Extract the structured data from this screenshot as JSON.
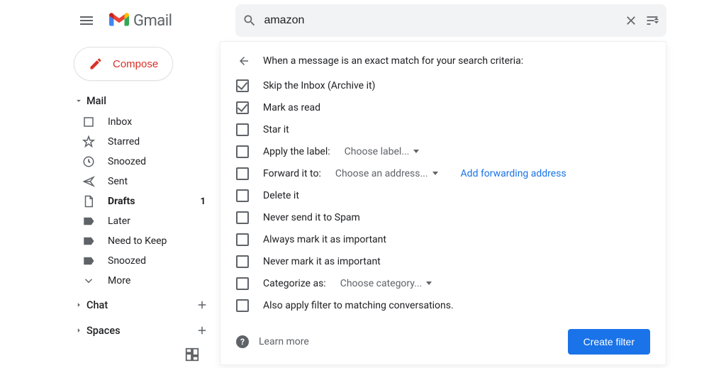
{
  "app": {
    "name": "Gmail"
  },
  "search": {
    "query": "amazon"
  },
  "compose": {
    "label": "Compose"
  },
  "sidebar": {
    "sections": {
      "mail": "Mail",
      "chat": "Chat",
      "spaces": "Spaces"
    },
    "items": [
      {
        "label": "Inbox"
      },
      {
        "label": "Starred"
      },
      {
        "label": "Snoozed"
      },
      {
        "label": "Sent"
      },
      {
        "label": "Drafts",
        "count": "1",
        "bold": true
      },
      {
        "label": "Later"
      },
      {
        "label": "Need to Keep"
      },
      {
        "label": "Snoozed"
      },
      {
        "label": "More"
      }
    ]
  },
  "filter": {
    "header": "When a message is an exact match for your search criteria:",
    "options": [
      {
        "label": "Skip the Inbox (Archive it)",
        "checked": true
      },
      {
        "label": "Mark as read",
        "checked": true
      },
      {
        "label": "Star it",
        "checked": false
      },
      {
        "label": "Apply the label:",
        "checked": false,
        "select": "Choose label..."
      },
      {
        "label": "Forward it to:",
        "checked": false,
        "select": "Choose an address...",
        "link": "Add forwarding address"
      },
      {
        "label": "Delete it",
        "checked": false
      },
      {
        "label": "Never send it to Spam",
        "checked": false
      },
      {
        "label": "Always mark it as important",
        "checked": false
      },
      {
        "label": "Never mark it as important",
        "checked": false
      },
      {
        "label": "Categorize as:",
        "checked": false,
        "select": "Choose category..."
      },
      {
        "label": "Also apply filter to matching conversations.",
        "checked": false
      }
    ],
    "learn_more": "Learn more",
    "create_button": "Create filter"
  }
}
